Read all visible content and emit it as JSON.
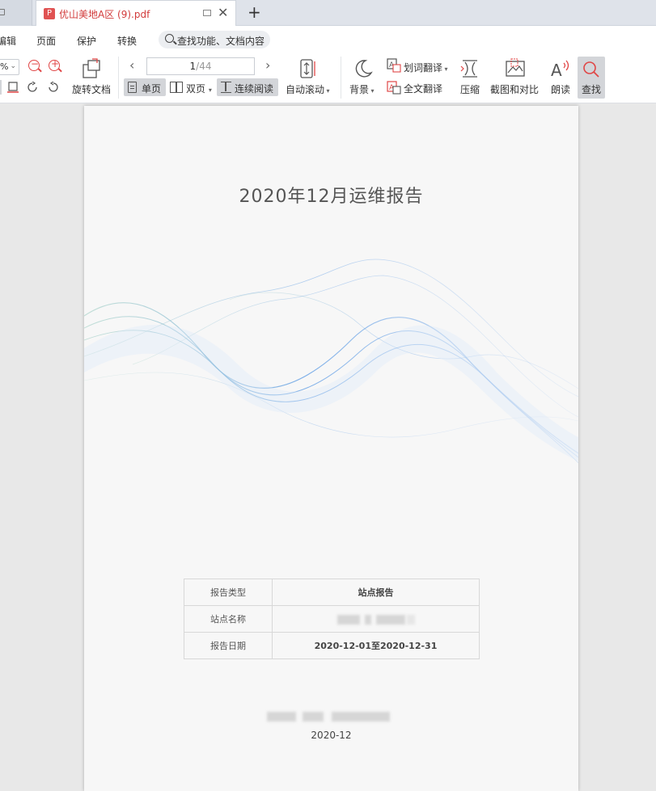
{
  "tabs": {
    "active_title": "优山美地A区 (9).pdf",
    "pdf_badge": "P",
    "close_glyph": "✕",
    "add_glyph": "+"
  },
  "menu": {
    "items": [
      "编辑",
      "页面",
      "保护",
      "转换"
    ],
    "search_label": "查找功能、文档内容"
  },
  "toolbar": {
    "zoom_value": "%",
    "rotate_doc": "旋转文档",
    "page_current": "1",
    "page_total": "/44",
    "single_page": "单页",
    "double_page": "双页",
    "continuous_read": "连续阅读",
    "auto_scroll": "自动滚动",
    "background": "背景",
    "word_translate": "划词翻译",
    "full_translate": "全文翻译",
    "compress": "压缩",
    "screenshot_compare": "截图和对比",
    "read_aloud": "朗读",
    "find": "查找"
  },
  "document": {
    "title": "2020年12月运维报告",
    "table": [
      {
        "key": "报告类型",
        "value": "站点报告"
      },
      {
        "key": "站点名称",
        "value": ""
      },
      {
        "key": "报告日期",
        "value": "2020-12-01至2020-12-31"
      }
    ],
    "footer_date": "2020-12"
  },
  "colors": {
    "accent_red": "#e04646",
    "tab_title": "#d23b3b",
    "wave_blue": "#4a90e2"
  }
}
